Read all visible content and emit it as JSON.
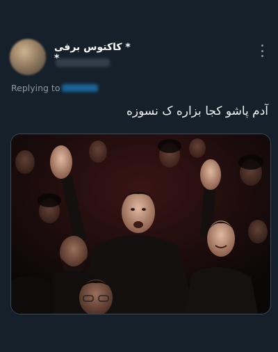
{
  "author": {
    "display_name": "* کاکتوس برفی *"
  },
  "reply_context": {
    "label": "Replying to"
  },
  "tweet": {
    "text": "آدم پاشو کجا بزاره ک نسوزه"
  },
  "icons": {
    "more": "more-vertical-icon"
  },
  "colors": {
    "background": "#15202b",
    "text": "#ffffff",
    "muted": "#8b98a5",
    "link": "#1d9bf0"
  }
}
